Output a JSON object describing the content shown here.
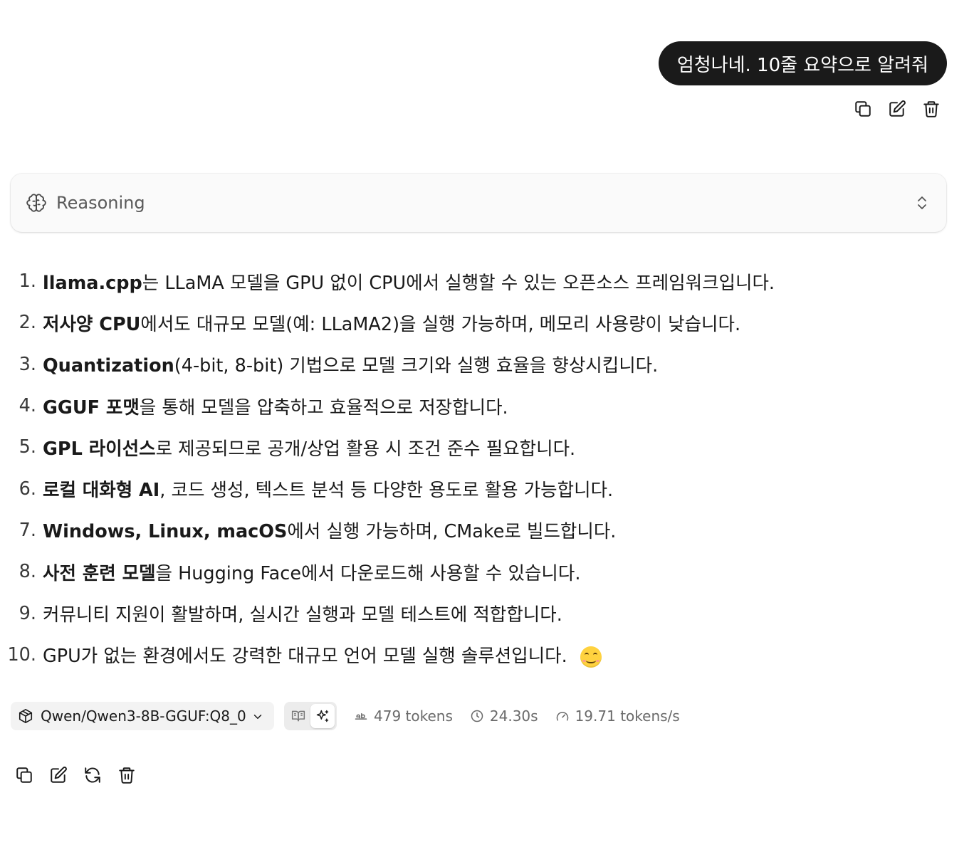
{
  "user_message": {
    "text": "엄청나네. 10줄 요약으로 알려줘",
    "actions": [
      "copy-icon",
      "edit-icon",
      "trash-icon"
    ]
  },
  "reasoning": {
    "label": "Reasoning"
  },
  "summary": [
    {
      "num": "1.",
      "bold": "llama.cpp",
      "text": "는 LLaMA 모델을 GPU 없이 CPU에서 실행할 수 있는 오픈소스 프레임워크입니다."
    },
    {
      "num": "2.",
      "bold": "저사양 CPU",
      "text": "에서도 대규모 모델(예: LLaMA2)을 실행 가능하며, 메모리 사용량이 낮습니다."
    },
    {
      "num": "3.",
      "bold": "Quantization",
      "text": "(4-bit, 8-bit) 기법으로 모델 크기와 실행 효율을 향상시킵니다."
    },
    {
      "num": "4.",
      "bold": "GGUF 포맷",
      "text": "을 통해 모델을 압축하고 효율적으로 저장합니다."
    },
    {
      "num": "5.",
      "bold": "GPL 라이선스",
      "text": "로 제공되므로 공개/상업 활용 시 조건 준수 필요합니다."
    },
    {
      "num": "6.",
      "bold": "로컬 대화형 AI",
      "text": ", 코드 생성, 텍스트 분석 등 다양한 용도로 활용 가능합니다."
    },
    {
      "num": "7.",
      "bold": "Windows, Linux, macOS",
      "text": "에서 실행 가능하며, CMake로 빌드합니다."
    },
    {
      "num": "8.",
      "bold": "사전 훈련 모델",
      "text": "을 Hugging Face에서 다운로드해 사용할 수 있습니다."
    },
    {
      "num": "9.",
      "bold": "",
      "text": "커뮤니티 지원이 활발하며, 실시간 실행과 모델 테스트에 적합합니다."
    },
    {
      "num": "10.",
      "bold": "",
      "text": "GPU가 없는 환경에서도 강력한 대규모 언어 모델 실행 솔루션입니다. ",
      "emoji": "smiling-face-emoji"
    }
  ],
  "meta": {
    "model": "Qwen/Qwen3-8B-GGUF:Q8_0",
    "tokens": "479 tokens",
    "duration": "24.30s",
    "speed": "19.71 tokens/s"
  },
  "assistant_actions": [
    "copy-icon",
    "edit-icon",
    "regenerate-icon",
    "trash-icon"
  ]
}
